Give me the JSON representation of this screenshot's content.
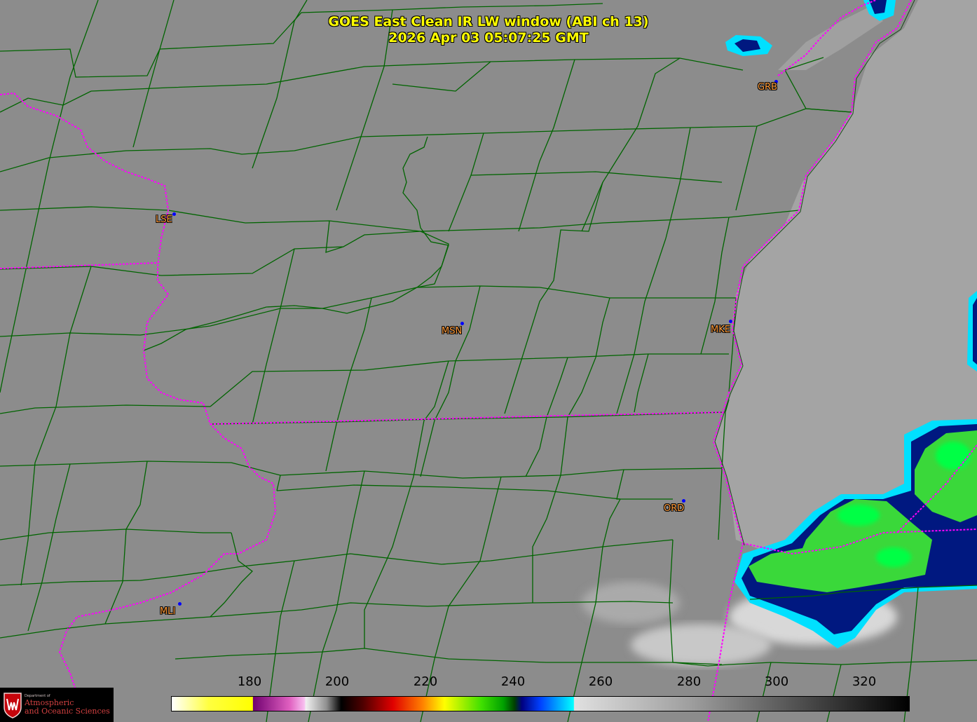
{
  "title": {
    "line1": "GOES East Clean IR LW window (ABI ch 13)",
    "line2": "2026 Apr 03  05:07:25 GMT"
  },
  "stations": [
    {
      "id": "GRB",
      "label": "GRB"
    },
    {
      "id": "LSE",
      "label": "LSE"
    },
    {
      "id": "MSN",
      "label": "MSN"
    },
    {
      "id": "MKE",
      "label": "MKE"
    },
    {
      "id": "ORD",
      "label": "ORD"
    },
    {
      "id": "MLI",
      "label": "MLI"
    }
  ],
  "colorbar": {
    "ticks": [
      "180",
      "200",
      "220",
      "240",
      "260",
      "280",
      "300",
      "320"
    ],
    "tick_values": [
      180,
      200,
      220,
      240,
      260,
      280,
      300,
      320
    ],
    "range": [
      165,
      333
    ]
  },
  "logo": {
    "dept": "Department of",
    "line1": "Atmospheric",
    "line2": "and Oceanic Sciences"
  },
  "colors": {
    "background_gray": "#8c8c8c",
    "lake_gray": "#a4a4a4",
    "county_lines": "#006400",
    "state_lines": "#ff00ff",
    "title_text": "#ffff00",
    "station_label": "#ff9b3a",
    "station_dot": "#0000ff",
    "cloud_green": "#3ad83a",
    "cloud_blue": "#001880",
    "cloud_cyan": "#00e0ff"
  }
}
